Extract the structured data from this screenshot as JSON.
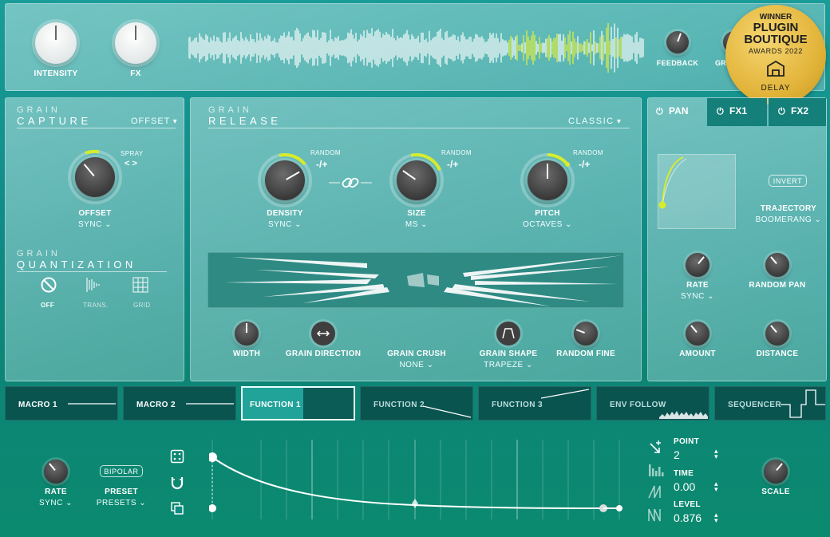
{
  "top": {
    "intensity_label": "INTENSITY",
    "fx_label": "FX",
    "feedback_label": "FEEDBACK",
    "grain_label_partial": "GRA"
  },
  "badge": {
    "line1": "WINNER",
    "line2": "PLUGIN",
    "line3": "BOUTIQUE",
    "line4": "AWARDS 2022",
    "line5": "DELAY"
  },
  "capture": {
    "title_top": "GRAIN",
    "title_main": "CAPTURE",
    "mode": "OFFSET",
    "spray_label": "SPRAY",
    "spray_arrows": "< >",
    "knob_label": "OFFSET",
    "knob_sub": "SYNC"
  },
  "quant": {
    "title_top": "GRAIN",
    "title_main": "QUANTIZATION",
    "off": "OFF",
    "trans": "TRANS.",
    "grid": "GRID"
  },
  "release": {
    "title_top": "GRAIN",
    "title_main": "RELEASE",
    "mode": "CLASSIC",
    "random_label": "RANDOM",
    "random_value": "-/+",
    "density_label": "DENSITY",
    "density_sub": "SYNC",
    "size_label": "SIZE",
    "size_sub": "MS",
    "pitch_label": "PITCH",
    "pitch_sub": "OCTAVES",
    "width_label": "WIDTH",
    "direction_label": "GRAIN DIRECTION",
    "crush_label": "GRAIN CRUSH",
    "crush_sub": "NONE",
    "shape_label": "GRAIN SHAPE",
    "shape_sub": "TRAPEZE",
    "random_fine_label": "RANDOM FINE"
  },
  "fx_tabs": {
    "pan": "PAN",
    "fx1": "FX1",
    "fx2": "FX2"
  },
  "pan": {
    "invert": "INVERT",
    "trajectory_label": "TRAJECTORY",
    "trajectory_sub": "BOOMERANG",
    "rate_label": "RATE",
    "rate_sub": "SYNC",
    "random_pan_label": "RANDOM PAN",
    "amount_label": "AMOUNT",
    "distance_label": "DISTANCE"
  },
  "mod_tabs": [
    "MACRO 1",
    "MACRO 2",
    "FUNCTION 1",
    "FUNCTION 2",
    "FUNCTION 3",
    "ENV FOLLOW",
    "SEQUENCER"
  ],
  "func": {
    "rate_label": "RATE",
    "rate_sub": "SYNC",
    "bipolar": "BIPOLAR",
    "preset_label": "PRESET",
    "preset_sub": "PRESETS",
    "point_label": "POINT",
    "point_value": "2",
    "time_label": "TIME",
    "time_value": "0.00",
    "level_label": "LEVEL",
    "level_value": "0.876",
    "scale_label": "SCALE"
  },
  "colors": {
    "accent": "#d7ec2c",
    "bg": "#14948f",
    "tab_bg": "#0a5450"
  }
}
